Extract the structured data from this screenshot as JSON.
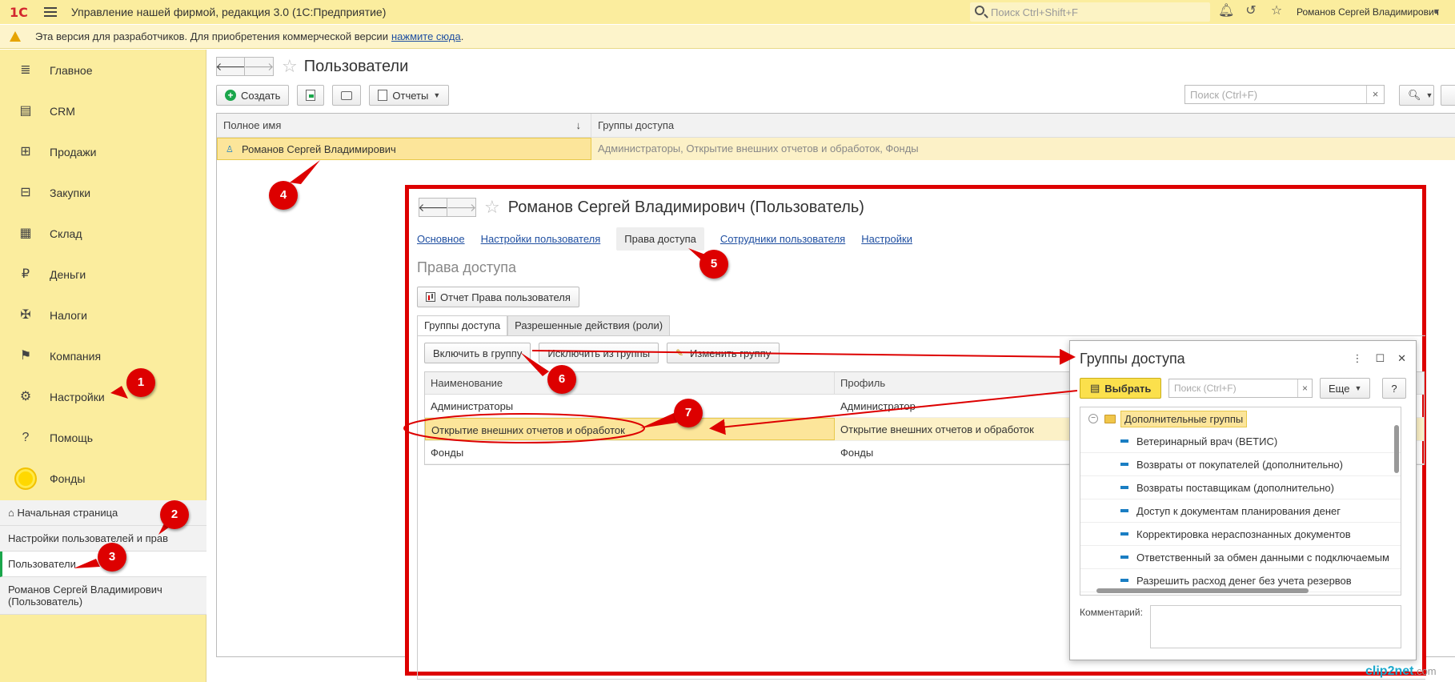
{
  "app": {
    "logo": "1С",
    "title": "Управление нашей фирмой, редакция 3.0  (1С:Предприятие)",
    "search_placeholder": "Поиск Ctrl+Shift+F",
    "user": "Романов Сергей Владимирович"
  },
  "warning": {
    "text": "Эта версия для разработчиков. Для приобретения коммерческой версии",
    "link": "нажмите сюда",
    "tail": "."
  },
  "sidebar": {
    "items": [
      {
        "label": "Главное",
        "icon": "list-icon"
      },
      {
        "label": "CRM",
        "icon": "crm-icon"
      },
      {
        "label": "Продажи",
        "icon": "basket-icon"
      },
      {
        "label": "Закупки",
        "icon": "cart-icon"
      },
      {
        "label": "Склад",
        "icon": "grid-icon"
      },
      {
        "label": "Деньги",
        "icon": "ruble-icon"
      },
      {
        "label": "Налоги",
        "icon": "emblem-icon"
      },
      {
        "label": "Компания",
        "icon": "flag-icon"
      },
      {
        "label": "Настройки",
        "icon": "gear-icon"
      },
      {
        "label": "Помощь",
        "icon": "help-icon"
      },
      {
        "label": "Фонды",
        "icon": "coin-icon"
      }
    ],
    "open_windows": [
      "Начальная страница",
      "Настройки пользователей и прав",
      "Пользователи",
      "Романов Сергей Владимирович (Пользователь)"
    ]
  },
  "main": {
    "title": "Пользователи",
    "create_label": "Создать",
    "reports_label": "Отчеты",
    "search_placeholder": "Поиск (Ctrl+F)",
    "columns": [
      "Полное имя",
      "Группы доступа"
    ],
    "sort_arrow": "↓",
    "rows": [
      {
        "name": "Романов Сергей Владимирович",
        "groups": "Администраторы, Открытие внешних отчетов и обработок, Фонды"
      }
    ]
  },
  "user_form": {
    "title": "Романов Сергей Владимирович (Пользователь)",
    "tabs": [
      "Основное",
      "Настройки пользователя",
      "Права доступа",
      "Сотрудники пользователя",
      "Настройки"
    ],
    "section": "Права доступа",
    "report_btn": "Отчет Права пользователя",
    "inner_tabs": [
      "Группы доступа",
      "Разрешенные действия (роли)"
    ],
    "buttons": [
      "Включить в группу",
      "Исключить из группы",
      "Изменить группу"
    ],
    "columns": [
      "Наименование",
      "Профиль"
    ],
    "rows": [
      {
        "name": "Администраторы",
        "profile": "Администратор"
      },
      {
        "name": "Открытие внешних отчетов и обработок",
        "profile": "Открытие внешних отчетов и обработок"
      },
      {
        "name": "Фонды",
        "profile": "Фонды"
      }
    ]
  },
  "dialog": {
    "title": "Группы доступа",
    "select_btn": "Выбрать",
    "search_placeholder": "Поиск (Ctrl+F)",
    "more_btn": "Еще",
    "help_btn": "?",
    "root": "Дополнительные группы",
    "items": [
      "Ветеринарный врач (ВЕТИС)",
      "Возвраты от покупателей (дополнительно)",
      "Возвраты поставщикам (дополнительно)",
      "Доступ к документам планирования денег",
      "Корректировка нераспознанных документов",
      "Ответственный за обмен данными с подключаемым",
      "Разрешить расход денег без учета резервов"
    ],
    "comment_label": "Комментарий:"
  },
  "markers": [
    "1",
    "2",
    "3",
    "4",
    "5",
    "6",
    "7"
  ],
  "watermark": {
    "brand": "clip2net",
    "suffix": ".com"
  },
  "colors": {
    "topbar": "#fbed9e",
    "accent_red": "#dd0000",
    "select_yellow": "#fbe04c"
  }
}
